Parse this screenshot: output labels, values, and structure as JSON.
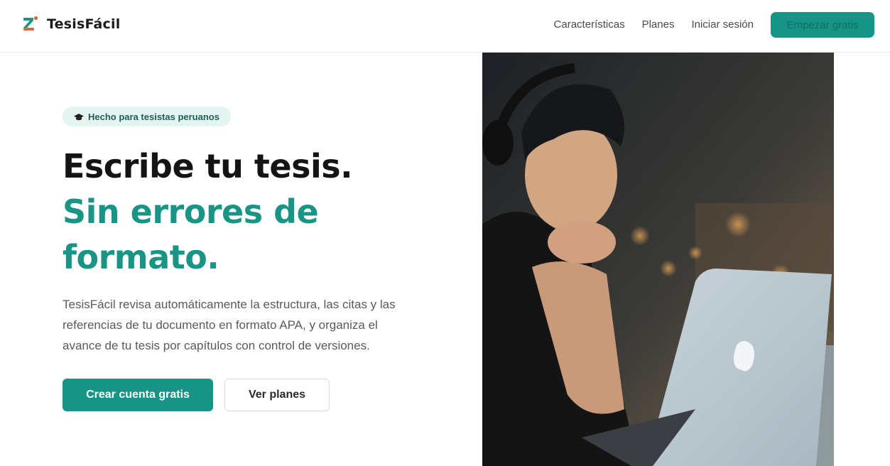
{
  "brand": {
    "name": "TesisFácil",
    "logo_icon": "z-logo-icon",
    "accent": "#179486"
  },
  "nav": {
    "links": [
      "Características",
      "Planes",
      "Iniciar sesión"
    ],
    "cta": "Empezar gratis"
  },
  "hero": {
    "badge": {
      "icon": "graduation-cap-icon",
      "text": "Hecho para tesistas peruanos"
    },
    "headline_line1": "Escribe tu tesis.",
    "headline_line2": "Sin errores de",
    "headline_line3": "formato.",
    "description": "TesisFácil revisa automáticamente la estructura, las citas y las referencias de tu documento en formato APA, y organiza el avance de tu tesis por capítulos con control de versiones.",
    "primary_button": "Crear cuenta gratis",
    "secondary_button": "Ver planes",
    "image": "photo of a student with headphones looking at a laptop"
  }
}
